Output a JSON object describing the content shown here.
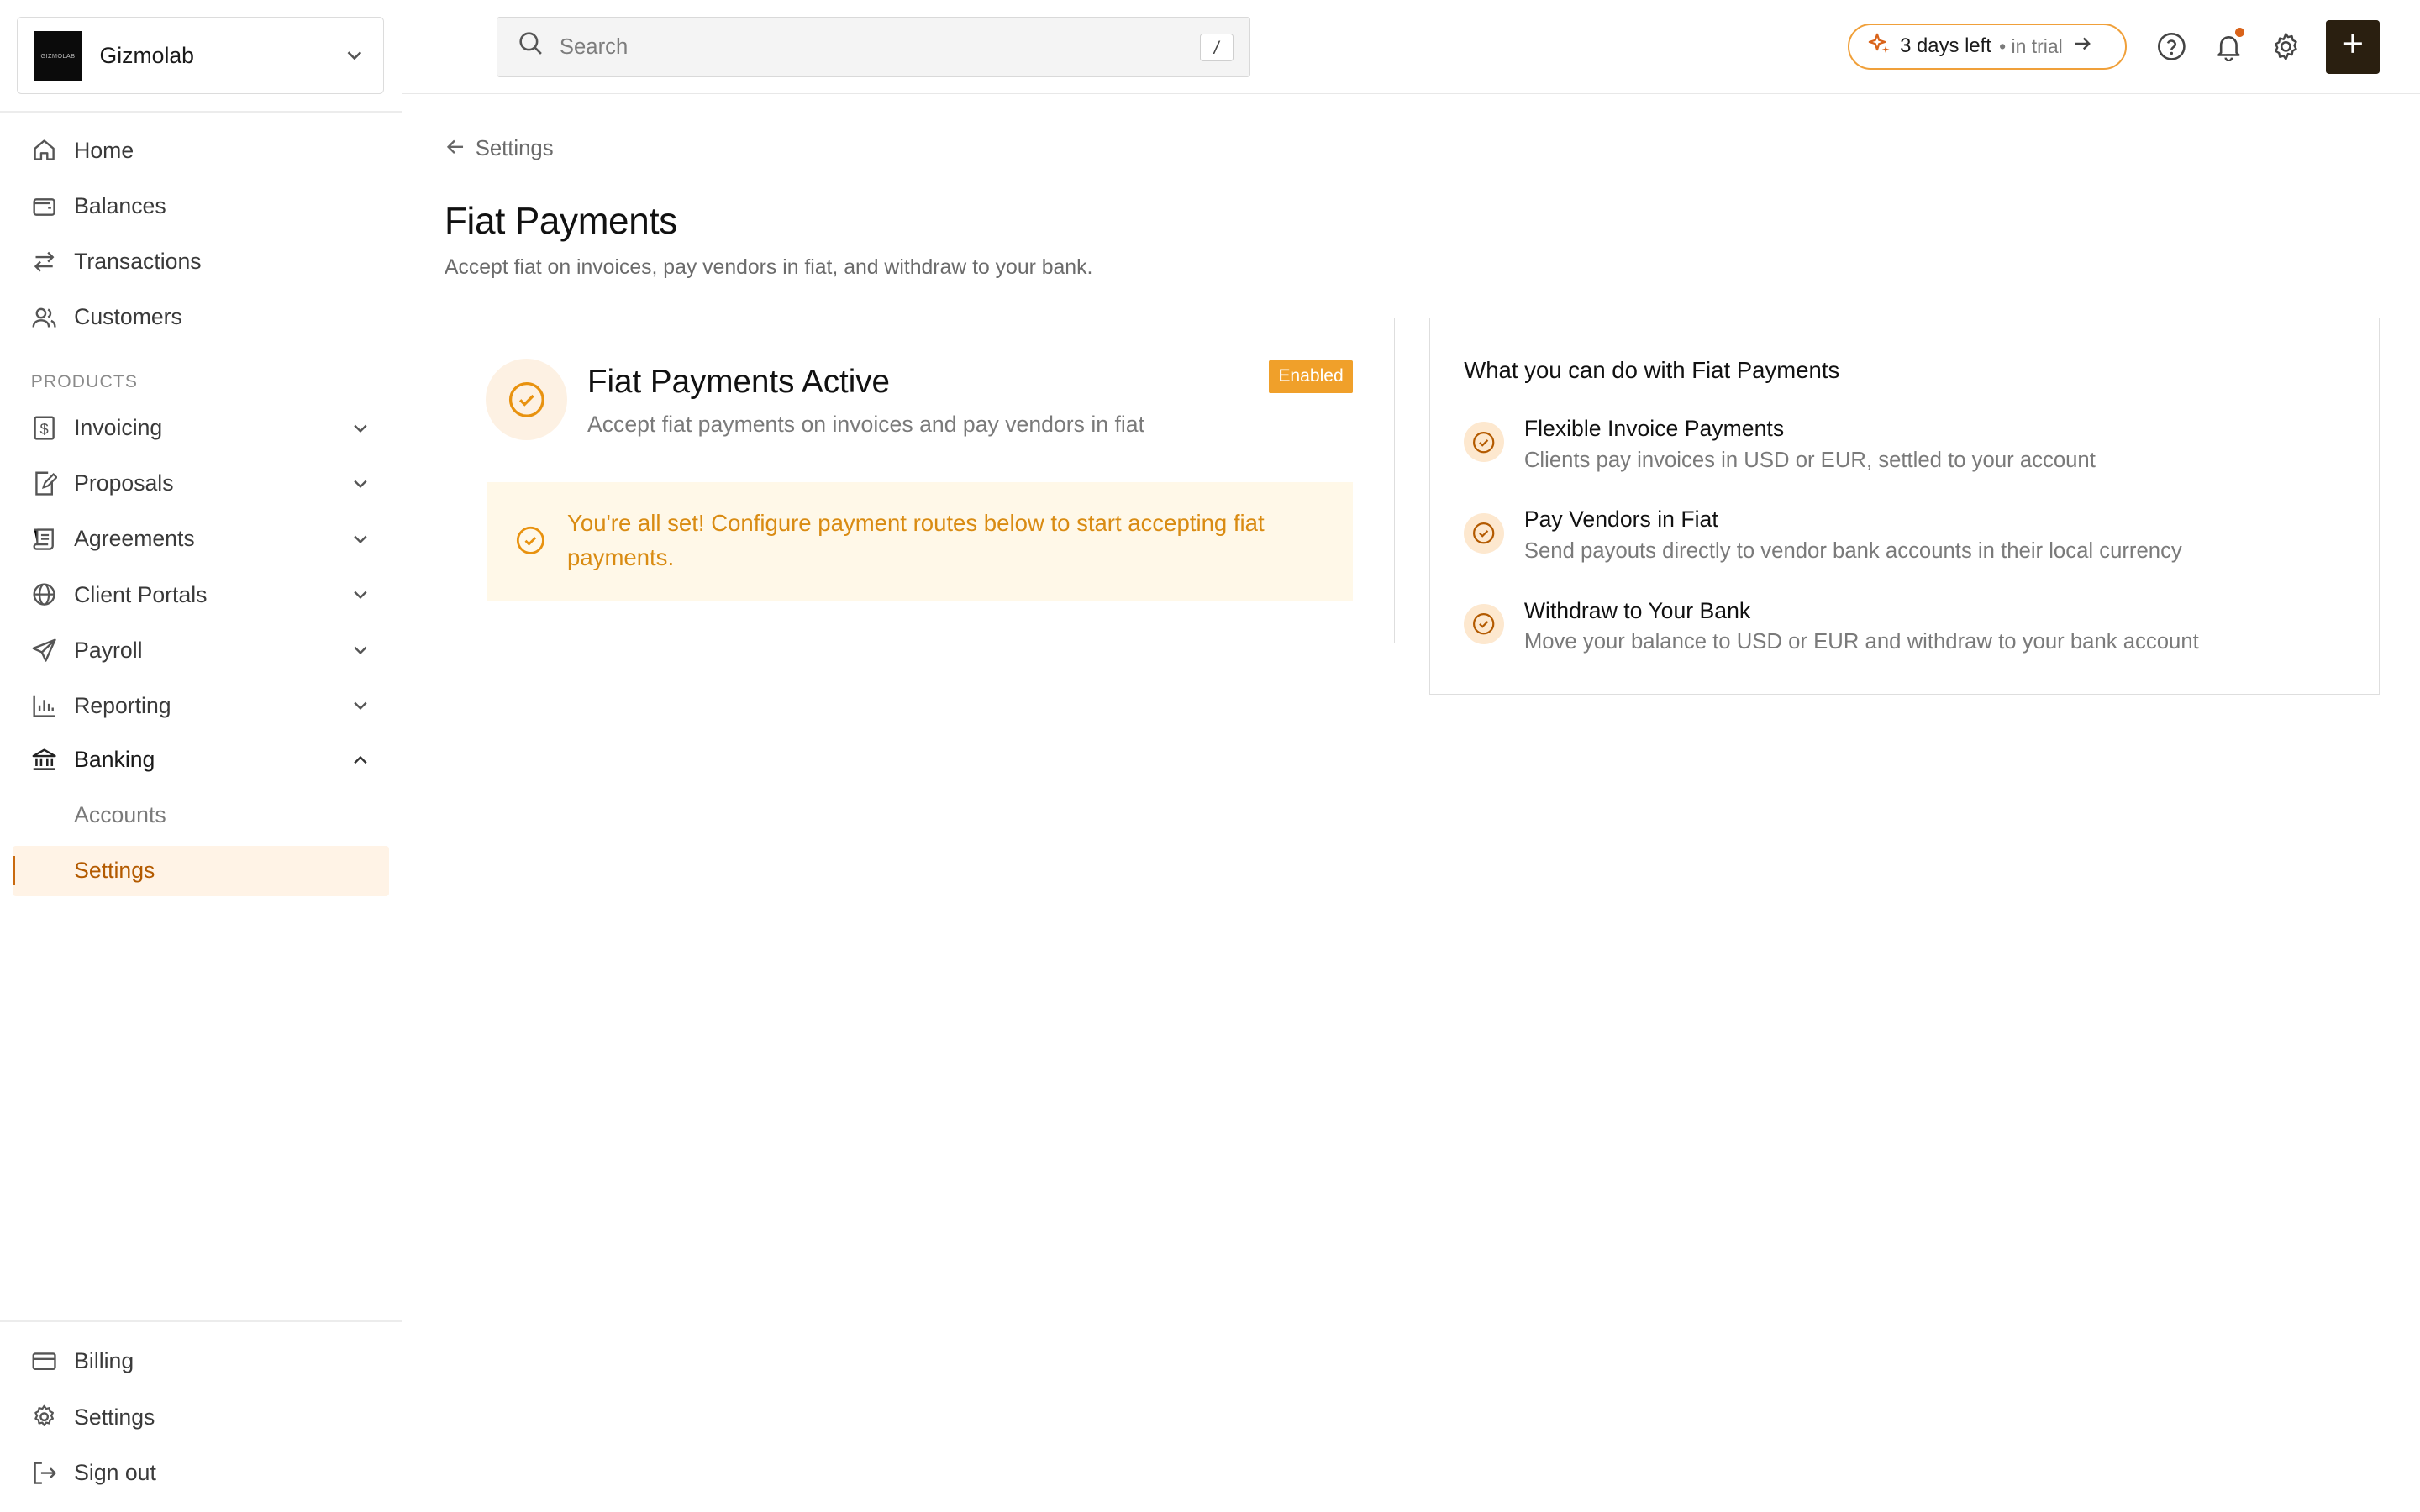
{
  "org": {
    "name": "Gizmolab",
    "logo_text": "GIZMOLAB"
  },
  "search": {
    "placeholder": "Search",
    "shortcut": "/"
  },
  "trial": {
    "strong": "3 days left",
    "weak": "• in trial"
  },
  "sidebar": {
    "items": [
      {
        "label": "Home",
        "icon": "home-icon"
      },
      {
        "label": "Balances",
        "icon": "wallet-icon"
      },
      {
        "label": "Transactions",
        "icon": "arrows-swap-icon"
      },
      {
        "label": "Customers",
        "icon": "users-icon"
      }
    ],
    "section_label": "PRODUCTS",
    "products": [
      {
        "label": "Invoicing",
        "icon": "dollar-doc-icon"
      },
      {
        "label": "Proposals",
        "icon": "pen-doc-icon"
      },
      {
        "label": "Agreements",
        "icon": "scroll-icon"
      },
      {
        "label": "Client Portals",
        "icon": "globe-icon"
      },
      {
        "label": "Payroll",
        "icon": "send-icon"
      },
      {
        "label": "Reporting",
        "icon": "bar-chart-icon"
      },
      {
        "label": "Banking",
        "icon": "bank-icon"
      }
    ],
    "banking_sub": [
      {
        "label": "Accounts"
      },
      {
        "label": "Settings"
      }
    ],
    "bottom": [
      {
        "label": "Billing",
        "icon": "card-icon"
      },
      {
        "label": "Settings",
        "icon": "gear-icon"
      },
      {
        "label": "Sign out",
        "icon": "sign-out-icon"
      }
    ]
  },
  "breadcrumb": {
    "back_label": "Settings"
  },
  "page": {
    "title": "Fiat Payments",
    "subtitle": "Accept fiat on invoices, pay vendors in fiat, and withdraw to your bank."
  },
  "status_card": {
    "title": "Fiat Payments Active",
    "description": "Accept fiat payments on invoices and pay vendors in fiat",
    "badge": "Enabled",
    "notice": "You're all set! Configure payment routes below to start accepting fiat payments."
  },
  "features_card": {
    "heading": "What you can do with Fiat Payments",
    "items": [
      {
        "title": "Flexible Invoice Payments",
        "desc": "Clients pay invoices in USD or EUR, settled to your account"
      },
      {
        "title": "Pay Vendors in Fiat",
        "desc": "Send payouts directly to vendor bank accounts in their local currency"
      },
      {
        "title": "Withdraw to Your Bank",
        "desc": "Move your balance to USD or EUR and withdraw to your bank account"
      }
    ]
  },
  "colors": {
    "accent": "#f0a02a",
    "accent_dark": "#b35a00",
    "notice_bg": "#fff8e8",
    "active_bg": "#fff3e6",
    "plus_bg": "#2a1f10"
  }
}
